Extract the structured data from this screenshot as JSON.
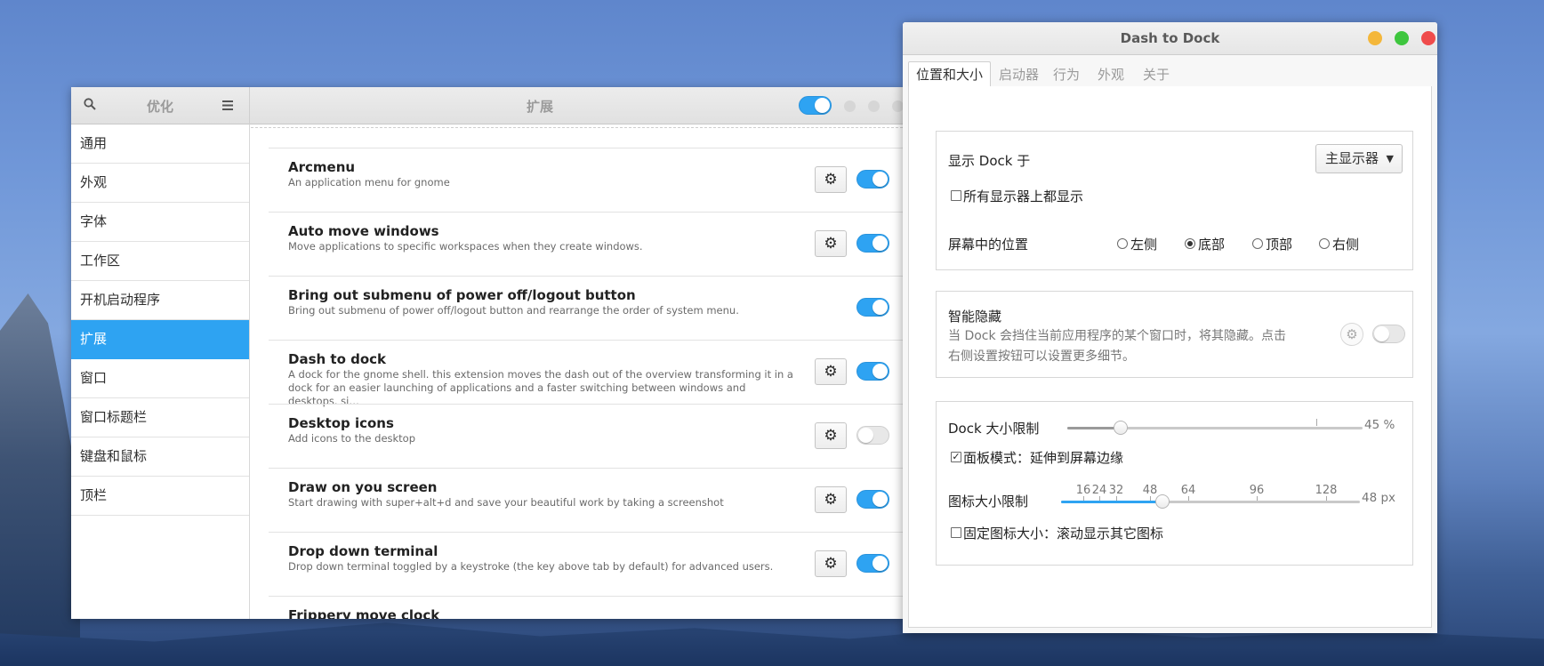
{
  "tweaks": {
    "app_title": "优化",
    "content_title": "扩展",
    "master_toggle_on": true,
    "sidebar": [
      {
        "label": "通用",
        "active": false
      },
      {
        "label": "外观",
        "active": false
      },
      {
        "label": "字体",
        "active": false
      },
      {
        "label": "工作区",
        "active": false
      },
      {
        "label": "开机启动程序",
        "active": false
      },
      {
        "label": "扩展",
        "active": true
      },
      {
        "label": "窗口",
        "active": false
      },
      {
        "label": "窗口标题栏",
        "active": false
      },
      {
        "label": "键盘和鼠标",
        "active": false
      },
      {
        "label": "顶栏",
        "active": false
      }
    ],
    "extensions": [
      {
        "name": "Arcmenu",
        "desc": "An application menu for gnome",
        "has_settings": true,
        "enabled": true
      },
      {
        "name": "Auto move windows",
        "desc": "Move applications to specific workspaces when they create windows.",
        "has_settings": true,
        "enabled": true
      },
      {
        "name": "Bring out submenu of power off/logout button",
        "desc": "Bring out submenu of power off/logout button and rearrange the order of system menu.",
        "has_settings": false,
        "enabled": true
      },
      {
        "name": "Dash to dock",
        "desc": "A dock for the gnome shell. this extension moves the dash out of the overview transforming it in a dock for an easier launching of applications and a faster switching between windows and desktops. si…",
        "has_settings": true,
        "enabled": true
      },
      {
        "name": "Desktop icons",
        "desc": "Add icons to the desktop",
        "has_settings": true,
        "enabled": false
      },
      {
        "name": "Draw on you screen",
        "desc": "Start drawing with super+alt+d and save your beautiful work by taking a screenshot",
        "has_settings": true,
        "enabled": true
      },
      {
        "name": "Drop down terminal",
        "desc": "Drop down terminal toggled by a keystroke (the key above tab by default) for advanced users.",
        "has_settings": true,
        "enabled": true
      },
      {
        "name": "Frippery move clock",
        "desc": "",
        "has_settings": false,
        "enabled": false
      }
    ]
  },
  "dtd": {
    "title": "Dash to Dock",
    "tabs": [
      "位置和大小",
      "启动器",
      "行为",
      "外观",
      "关于"
    ],
    "active_tab": 0,
    "show_on_label": "显示 Dock 于",
    "show_on_value": "主显示器",
    "all_monitors_label": "所有显示器上都显示",
    "all_monitors_checked": false,
    "position_label": "屏幕中的位置",
    "positions": [
      "左侧",
      "底部",
      "顶部",
      "右侧"
    ],
    "position_selected": 1,
    "intellihide_label": "智能隐藏",
    "intellihide_desc1": "当 Dock 会挡住当前应用程序的某个窗口时，将其隐藏。点击",
    "intellihide_desc2": "右侧设置按钮可以设置更多细节。",
    "intellihide_on": false,
    "dock_size_label": "Dock 大小限制",
    "dock_size_value": "45 %",
    "dock_size_fraction": 0.18,
    "panel_mode_label": "面板模式：延伸到屏幕边缘",
    "panel_mode_checked": true,
    "icon_size_label": "图标大小限制",
    "icon_size_value": "48 px",
    "icon_ticks": [
      "16",
      "24",
      "32",
      "48",
      "64",
      "96",
      "128"
    ],
    "icon_size_fraction": 0.34,
    "fixed_icon_label": "固定图标大小：滚动显示其它图标",
    "fixed_icon_checked": false
  },
  "colors": {
    "accent": "#2ea3f2",
    "close": "#ef4b4b",
    "minimize": "#f4b73b",
    "maximize": "#3ec63e"
  },
  "icons": {
    "search": "search-icon",
    "menu": "hamburger-icon",
    "gear": "gear-icon",
    "dropdown": "triangle-down-icon"
  }
}
